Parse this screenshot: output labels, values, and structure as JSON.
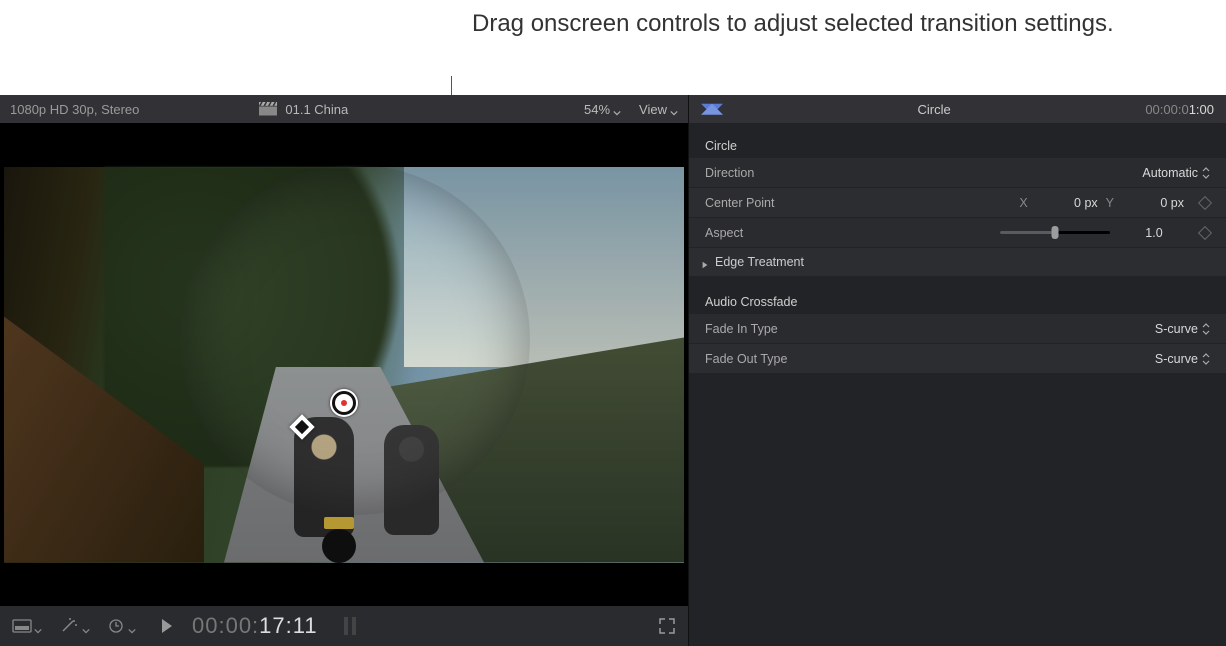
{
  "callout": "Drag onscreen controls to adjust selected transition settings.",
  "viewer": {
    "format": "1080p HD 30p, Stereo",
    "clip_name": "01.1 China",
    "zoom": "54%",
    "view_label": "View"
  },
  "playhead": {
    "prefix": "00:00:",
    "emphasis": "17:11"
  },
  "inspector": {
    "title": "Circle",
    "duration_prefix": "00:00:0",
    "duration_emphasis": "1:00",
    "section_circle": "Circle",
    "direction": {
      "label": "Direction",
      "value": "Automatic"
    },
    "center_point": {
      "label": "Center Point",
      "x_label": "X",
      "x_value": "0 px",
      "y_label": "Y",
      "y_value": "0 px"
    },
    "aspect": {
      "label": "Aspect",
      "value": "1.0"
    },
    "edge_treatment": "Edge Treatment",
    "section_audio": "Audio Crossfade",
    "fade_in": {
      "label": "Fade In Type",
      "value": "S-curve"
    },
    "fade_out": {
      "label": "Fade Out Type",
      "value": "S-curve"
    }
  }
}
